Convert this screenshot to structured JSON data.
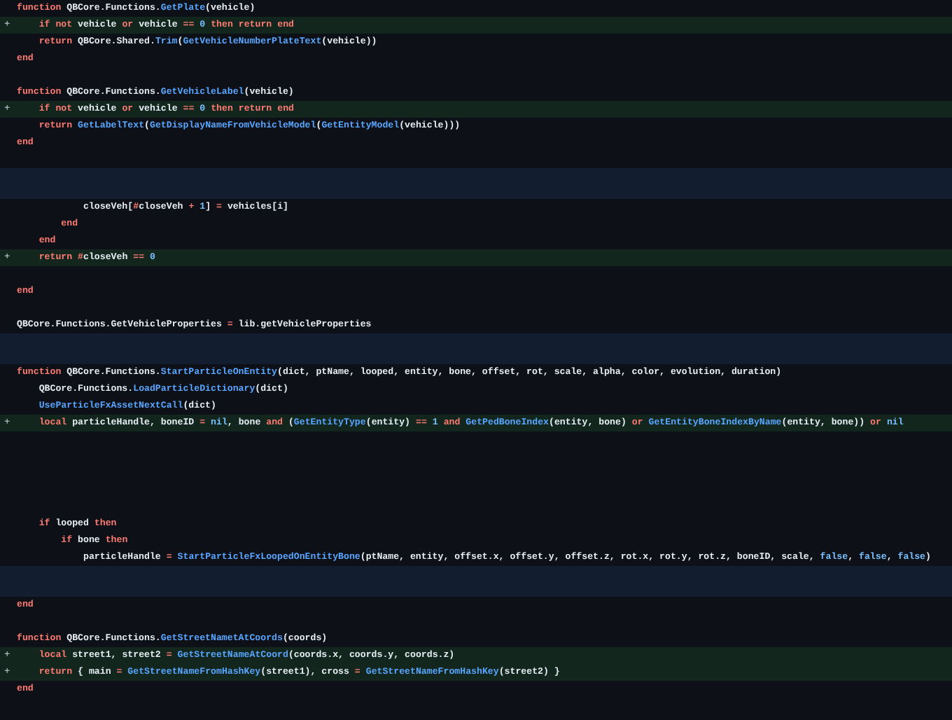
{
  "diff_lines": [
    {
      "kind": "context",
      "text": "function QBCore.Functions.GetPlate(vehicle)"
    },
    {
      "kind": "added",
      "marker": "+",
      "text": "    if not vehicle or vehicle == 0 then return end"
    },
    {
      "kind": "context",
      "text": "    return QBCore.Shared.Trim(GetVehicleNumberPlateText(vehicle))"
    },
    {
      "kind": "context",
      "text": "end"
    },
    {
      "kind": "context"
    },
    {
      "kind": "context",
      "text": "function QBCore.Functions.GetVehicleLabel(vehicle)"
    },
    {
      "kind": "added",
      "marker": "+",
      "text": "    if not vehicle or vehicle == 0 then return end"
    },
    {
      "kind": "context",
      "text": "    return GetLabelText(GetDisplayNameFromVehicleModel(GetEntityModel(vehicle)))"
    },
    {
      "kind": "context",
      "text": "end"
    },
    {
      "kind": "context"
    },
    {
      "kind": "hunk"
    },
    {
      "kind": "context",
      "text": "            closeVeh[#closeVeh + 1] = vehicles[i]"
    },
    {
      "kind": "context",
      "text": "        end"
    },
    {
      "kind": "context",
      "text": "    end"
    },
    {
      "kind": "added",
      "marker": "+",
      "text": "    return #closeVeh == 0"
    },
    {
      "kind": "context"
    },
    {
      "kind": "context",
      "text": "end"
    },
    {
      "kind": "context"
    },
    {
      "kind": "context",
      "text": "QBCore.Functions.GetVehicleProperties = lib.getVehicleProperties"
    },
    {
      "kind": "hunk"
    },
    {
      "kind": "context",
      "text": "function QBCore.Functions.StartParticleOnEntity(dict, ptName, looped, entity, bone, offset, rot, scale, alpha, color, evolution, duration)"
    },
    {
      "kind": "context",
      "text": "    QBCore.Functions.LoadParticleDictionary(dict)"
    },
    {
      "kind": "context",
      "text": "    UseParticleFxAssetNextCall(dict)"
    },
    {
      "kind": "added",
      "marker": "+",
      "text": "    local particleHandle, boneID = nil, bone and (GetEntityType(entity) == 1 and GetPedBoneIndex(entity, bone) or GetEntityBoneIndexByName(entity, bone)) or nil"
    },
    {
      "kind": "context"
    },
    {
      "kind": "context"
    },
    {
      "kind": "context"
    },
    {
      "kind": "context"
    },
    {
      "kind": "context"
    },
    {
      "kind": "context",
      "text": "    if looped then"
    },
    {
      "kind": "context",
      "text": "        if bone then"
    },
    {
      "kind": "context",
      "text": "            particleHandle = StartParticleFxLoopedOnEntityBone(ptName, entity, offset.x, offset.y, offset.z, rot.x, rot.y, rot.z, boneID, scale, false, false, false)"
    },
    {
      "kind": "hunk"
    },
    {
      "kind": "context",
      "text": "end"
    },
    {
      "kind": "context"
    },
    {
      "kind": "context",
      "text": "function QBCore.Functions.GetStreetNametAtCoords(coords)"
    },
    {
      "kind": "added",
      "marker": "+",
      "text": "    local street1, street2 = GetStreetNameAtCoord(coords.x, coords.y, coords.z)"
    },
    {
      "kind": "added",
      "marker": "+",
      "text": "    return { main = GetStreetNameFromHashKey(street1), cross = GetStreetNameFromHashKey(street2) }"
    },
    {
      "kind": "context",
      "text": "end"
    },
    {
      "kind": "context"
    }
  ]
}
